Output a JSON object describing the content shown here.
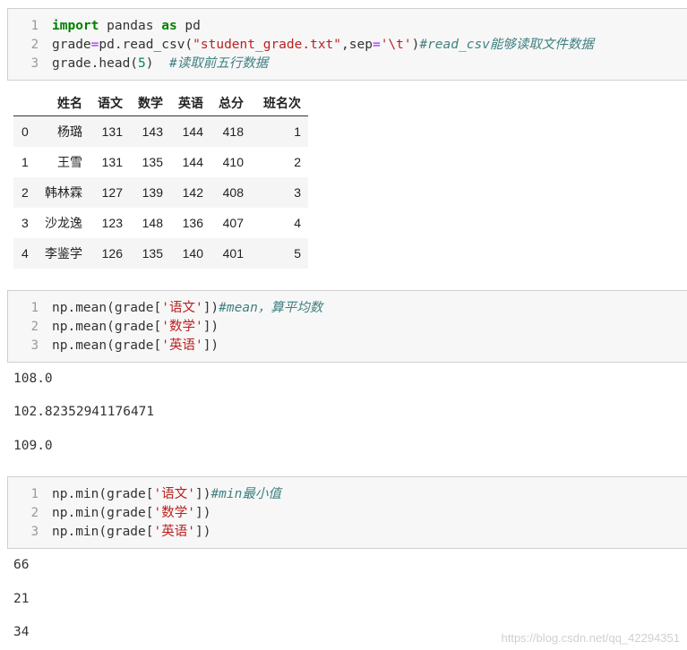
{
  "cells": [
    {
      "line_numbers": [
        "1",
        "2",
        "3"
      ],
      "lines": [
        [
          {
            "t": "import",
            "c": "kw"
          },
          {
            "t": " pandas ",
            "c": ""
          },
          {
            "t": "as",
            "c": "kw"
          },
          {
            "t": " pd",
            "c": ""
          }
        ],
        [
          {
            "t": "grade",
            "c": ""
          },
          {
            "t": "=",
            "c": "op"
          },
          {
            "t": "pd.read_csv(",
            "c": ""
          },
          {
            "t": "\"student_grade.txt\"",
            "c": "str"
          },
          {
            "t": ",sep",
            "c": ""
          },
          {
            "t": "=",
            "c": "op"
          },
          {
            "t": "'\\t'",
            "c": "str"
          },
          {
            "t": ")",
            "c": ""
          },
          {
            "t": "#read_csv能够读取文件数据",
            "c": "cm"
          }
        ],
        [
          {
            "t": "grade.head(",
            "c": ""
          },
          {
            "t": "5",
            "c": "num"
          },
          {
            "t": ")  ",
            "c": ""
          },
          {
            "t": "#读取前五行数据",
            "c": "cm"
          }
        ]
      ]
    },
    {
      "line_numbers": [
        "1",
        "2",
        "3"
      ],
      "lines": [
        [
          {
            "t": "np.mean(grade[",
            "c": ""
          },
          {
            "t": "'语文'",
            "c": "str"
          },
          {
            "t": "])",
            "c": ""
          },
          {
            "t": "#mean，算平均数",
            "c": "cm"
          }
        ],
        [
          {
            "t": "np.mean(grade[",
            "c": ""
          },
          {
            "t": "'数学'",
            "c": "str"
          },
          {
            "t": "])",
            "c": ""
          }
        ],
        [
          {
            "t": "np.mean(grade[",
            "c": ""
          },
          {
            "t": "'英语'",
            "c": "str"
          },
          {
            "t": "])",
            "c": ""
          }
        ]
      ]
    },
    {
      "line_numbers": [
        "1",
        "2",
        "3"
      ],
      "lines": [
        [
          {
            "t": "np.min(grade[",
            "c": ""
          },
          {
            "t": "'语文'",
            "c": "str"
          },
          {
            "t": "])",
            "c": ""
          },
          {
            "t": "#min最小值",
            "c": "cm"
          }
        ],
        [
          {
            "t": "np.min(grade[",
            "c": ""
          },
          {
            "t": "'数学'",
            "c": "str"
          },
          {
            "t": "])",
            "c": ""
          }
        ],
        [
          {
            "t": "np.min(grade[",
            "c": ""
          },
          {
            "t": "'英语'",
            "c": "str"
          },
          {
            "t": "])",
            "c": ""
          }
        ]
      ]
    }
  ],
  "dataframe": {
    "columns": [
      "",
      "姓名",
      "语文",
      "数学",
      "英语",
      "总分",
      "班名次"
    ],
    "rows": [
      [
        "0",
        "杨璐",
        "131",
        "143",
        "144",
        "418",
        "1"
      ],
      [
        "1",
        "王雪",
        "131",
        "135",
        "144",
        "410",
        "2"
      ],
      [
        "2",
        "韩林霖",
        "127",
        "139",
        "142",
        "408",
        "3"
      ],
      [
        "3",
        "沙龙逸",
        "123",
        "148",
        "136",
        "407",
        "4"
      ],
      [
        "4",
        "李鉴学",
        "126",
        "135",
        "140",
        "401",
        "5"
      ]
    ]
  },
  "outputs_mean": [
    "108.0",
    "102.82352941176471",
    "109.0"
  ],
  "outputs_min": [
    "66",
    "21",
    "34"
  ],
  "watermark": "https://blog.csdn.net/qq_42294351"
}
